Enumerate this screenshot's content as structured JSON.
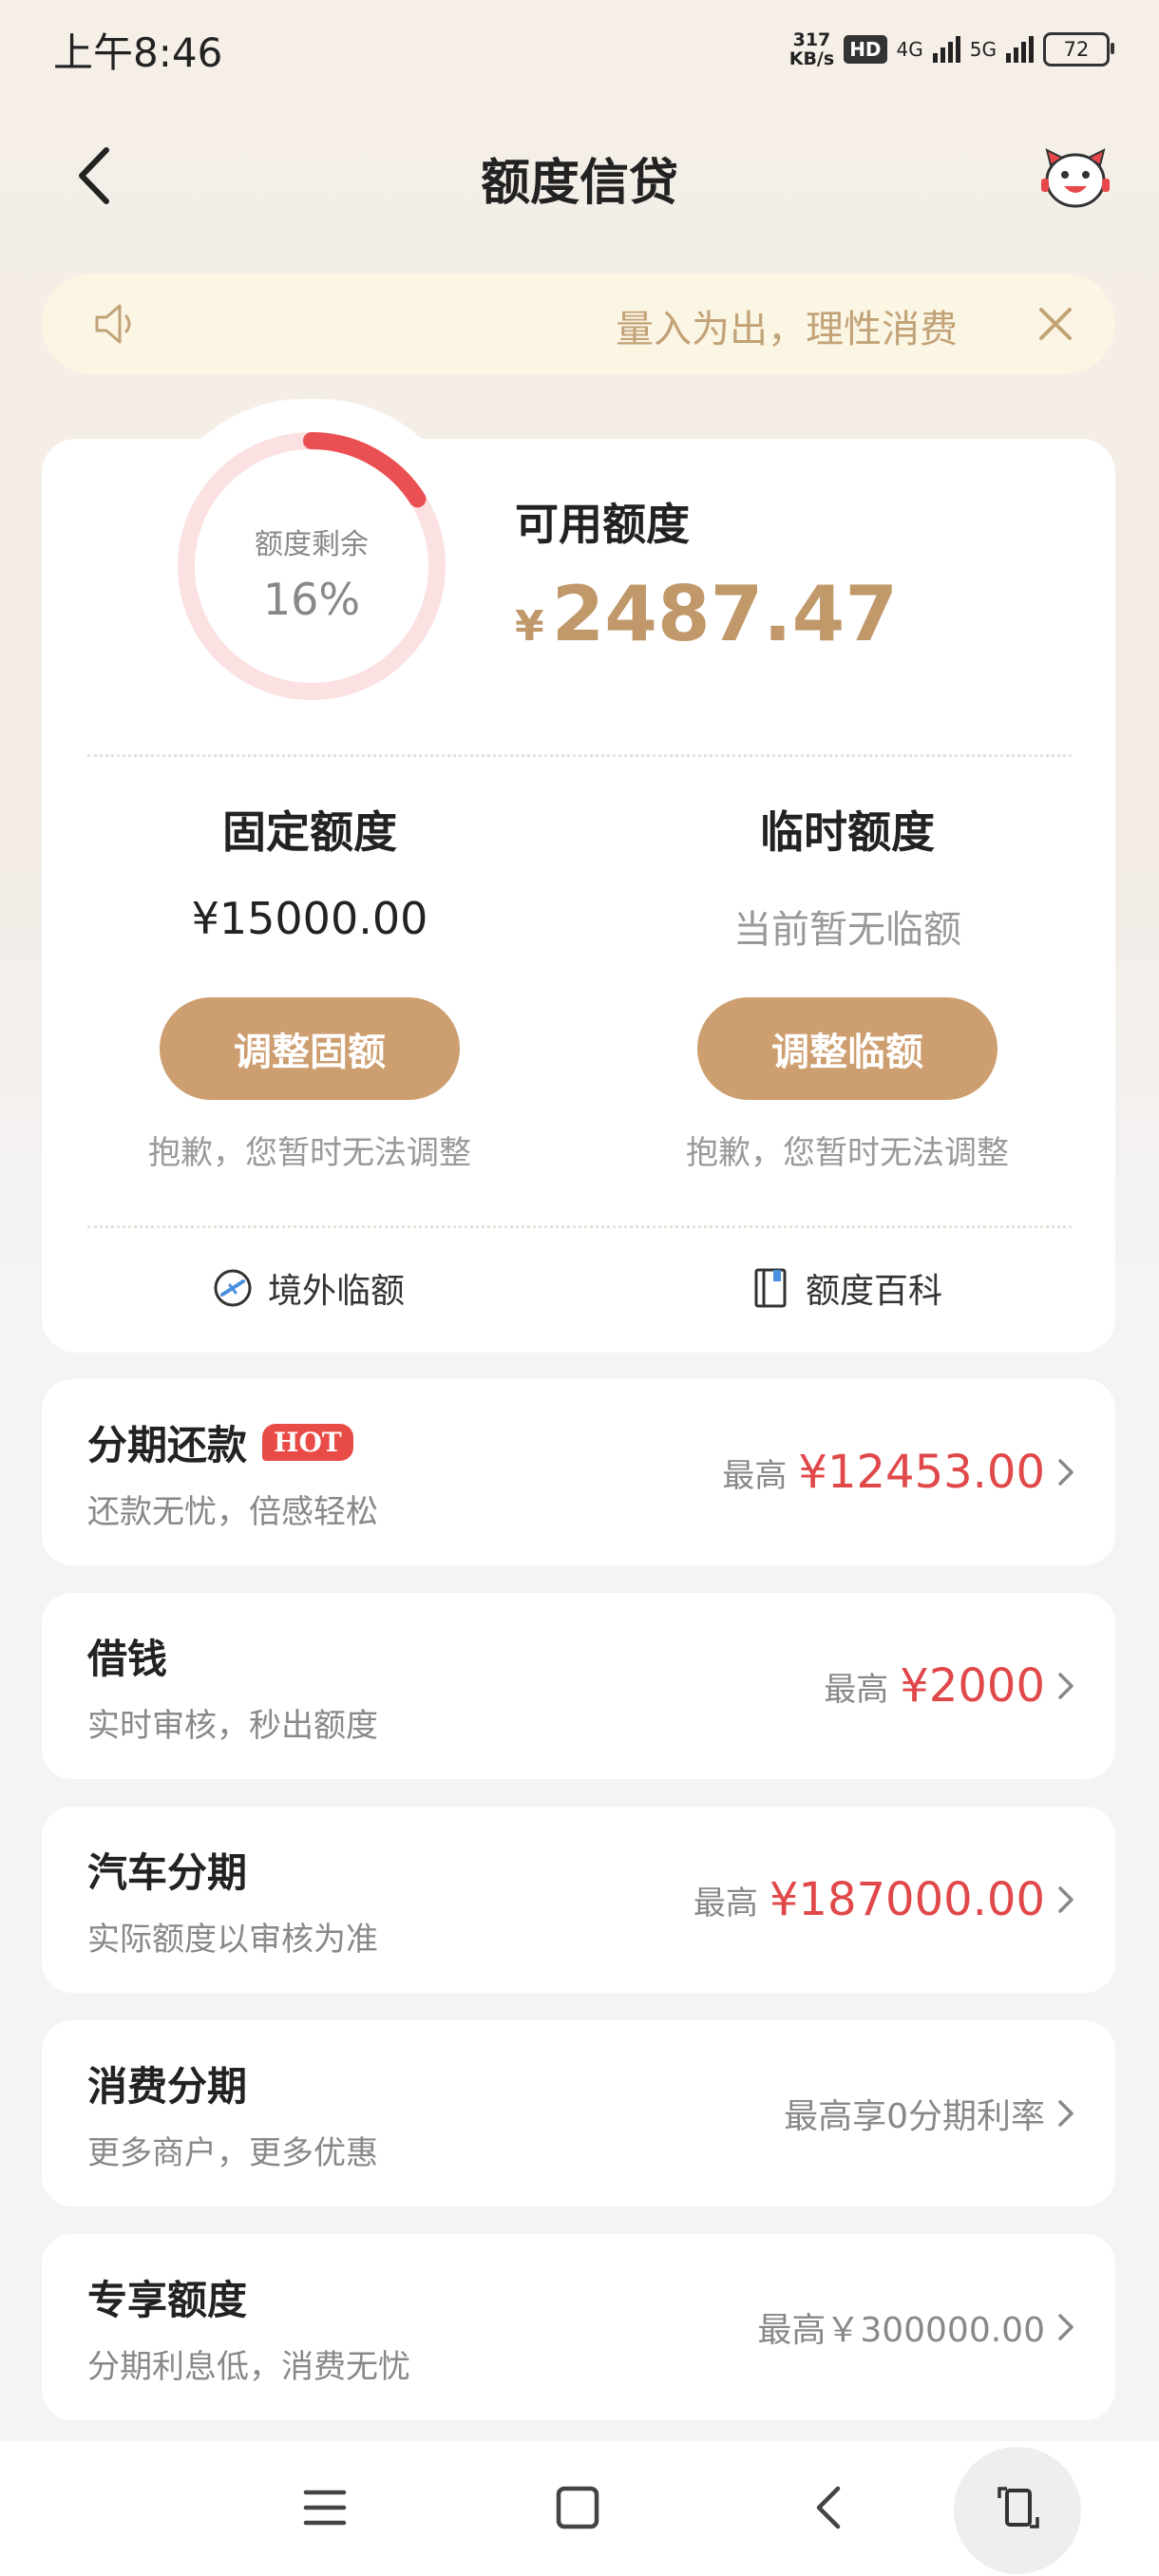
{
  "status_bar": {
    "time": "上午8:46",
    "net_speed_value": "317",
    "net_speed_unit": "KB/s",
    "hd": "HD",
    "net_4g": "4G",
    "net_5g": "5G",
    "battery": "72"
  },
  "header": {
    "title": "额度信贷",
    "back_icon": "chevron-left-icon",
    "mascot_icon": "mascot-icon"
  },
  "notice": {
    "text": "量入为出，理性消费",
    "speaker_icon": "speaker-icon",
    "close_icon": "close-icon"
  },
  "credit": {
    "gauge_label": "额度剩余",
    "gauge_percent": "16%",
    "gauge_fraction": 0.16,
    "available_label": "可用额度",
    "available_currency": "¥",
    "available_amount": "2487.47",
    "fixed": {
      "title": "固定额度",
      "value": "¥15000.00",
      "button": "调整固额",
      "note": "抱歉，您暂时无法调整"
    },
    "temporary": {
      "title": "临时额度",
      "value": "当前暂无临额",
      "button": "调整临额",
      "note": "抱歉，您暂时无法调整"
    },
    "links": {
      "overseas": "境外临额",
      "encyclopedia": "额度百科"
    }
  },
  "products": [
    {
      "title": "分期还款",
      "badge": "HOT",
      "subtitle": "还款无忧，倍感轻松",
      "prefix": "最高",
      "amount": "¥12453.00"
    },
    {
      "title": "借钱",
      "subtitle": "实时审核，秒出额度",
      "prefix": "最高",
      "amount": "¥2000"
    },
    {
      "title": "汽车分期",
      "subtitle": "实际额度以审核为准",
      "prefix": "最高",
      "amount": "¥187000.00"
    },
    {
      "title": "消费分期",
      "subtitle": "更多商户，更多优惠",
      "info": "最高享0分期利率"
    },
    {
      "title": "专享额度",
      "subtitle": "分期利息低，消费无忧",
      "info": "最高￥300000.00"
    }
  ],
  "colors": {
    "accent_gold": "#cd9e6f",
    "amount_gold": "#c0986a",
    "amount_red": "#e0484a",
    "gauge_red": "#e94f53",
    "gauge_track": "#fbe1e1"
  }
}
